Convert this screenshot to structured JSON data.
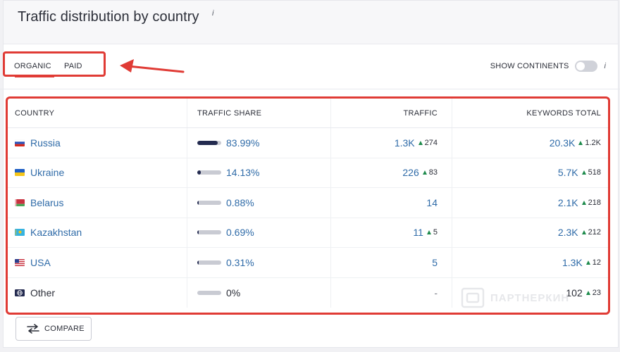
{
  "header": {
    "title": "Traffic distribution by country",
    "info": "i"
  },
  "tabs": [
    {
      "label": "ORGANIC",
      "active": true
    },
    {
      "label": "PAID",
      "active": false
    }
  ],
  "continents": {
    "label": "SHOW CONTINENTS",
    "enabled": false,
    "info": "i"
  },
  "table": {
    "columns": [
      "COUNTRY",
      "TRAFFIC SHARE",
      "TRAFFIC",
      "KEYWORDS TOTAL"
    ],
    "rows": [
      {
        "country": "Russia",
        "flag": "flag-russia-icon",
        "share": "83.99%",
        "share_value": 83.99,
        "traffic": "1.3K",
        "traffic_delta": "274",
        "keywords": "20.3K",
        "keywords_delta": "1.2K"
      },
      {
        "country": "Ukraine",
        "flag": "flag-ukraine-icon",
        "share": "14.13%",
        "share_value": 14.13,
        "traffic": "226",
        "traffic_delta": "83",
        "keywords": "5.7K",
        "keywords_delta": "518"
      },
      {
        "country": "Belarus",
        "flag": "flag-belarus-icon",
        "share": "0.88%",
        "share_value": 0.88,
        "traffic": "14",
        "traffic_delta": "",
        "keywords": "2.1K",
        "keywords_delta": "218"
      },
      {
        "country": "Kazakhstan",
        "flag": "flag-kazakhstan-icon",
        "share": "0.69%",
        "share_value": 0.69,
        "traffic": "11",
        "traffic_delta": "5",
        "keywords": "2.3K",
        "keywords_delta": "212"
      },
      {
        "country": "USA",
        "flag": "flag-usa-icon",
        "share": "0.31%",
        "share_value": 0.31,
        "traffic": "5",
        "traffic_delta": "",
        "keywords": "1.3K",
        "keywords_delta": "12"
      },
      {
        "country": "Other",
        "flag": "globe-icon",
        "share": "0%",
        "share_value": 0,
        "traffic": "-",
        "traffic_delta": "",
        "keywords": "102",
        "keywords_delta": "23"
      }
    ]
  },
  "compare": {
    "label": "COMPARE"
  },
  "watermark": {
    "text": "ПАРТНЕРКИН"
  },
  "colors": {
    "accent_red": "#e03b35",
    "link_blue": "#2f6ba8",
    "bar_dark": "#232a4f",
    "bar_track": "#c9cbd3",
    "delta_green": "#1d8a4b"
  }
}
